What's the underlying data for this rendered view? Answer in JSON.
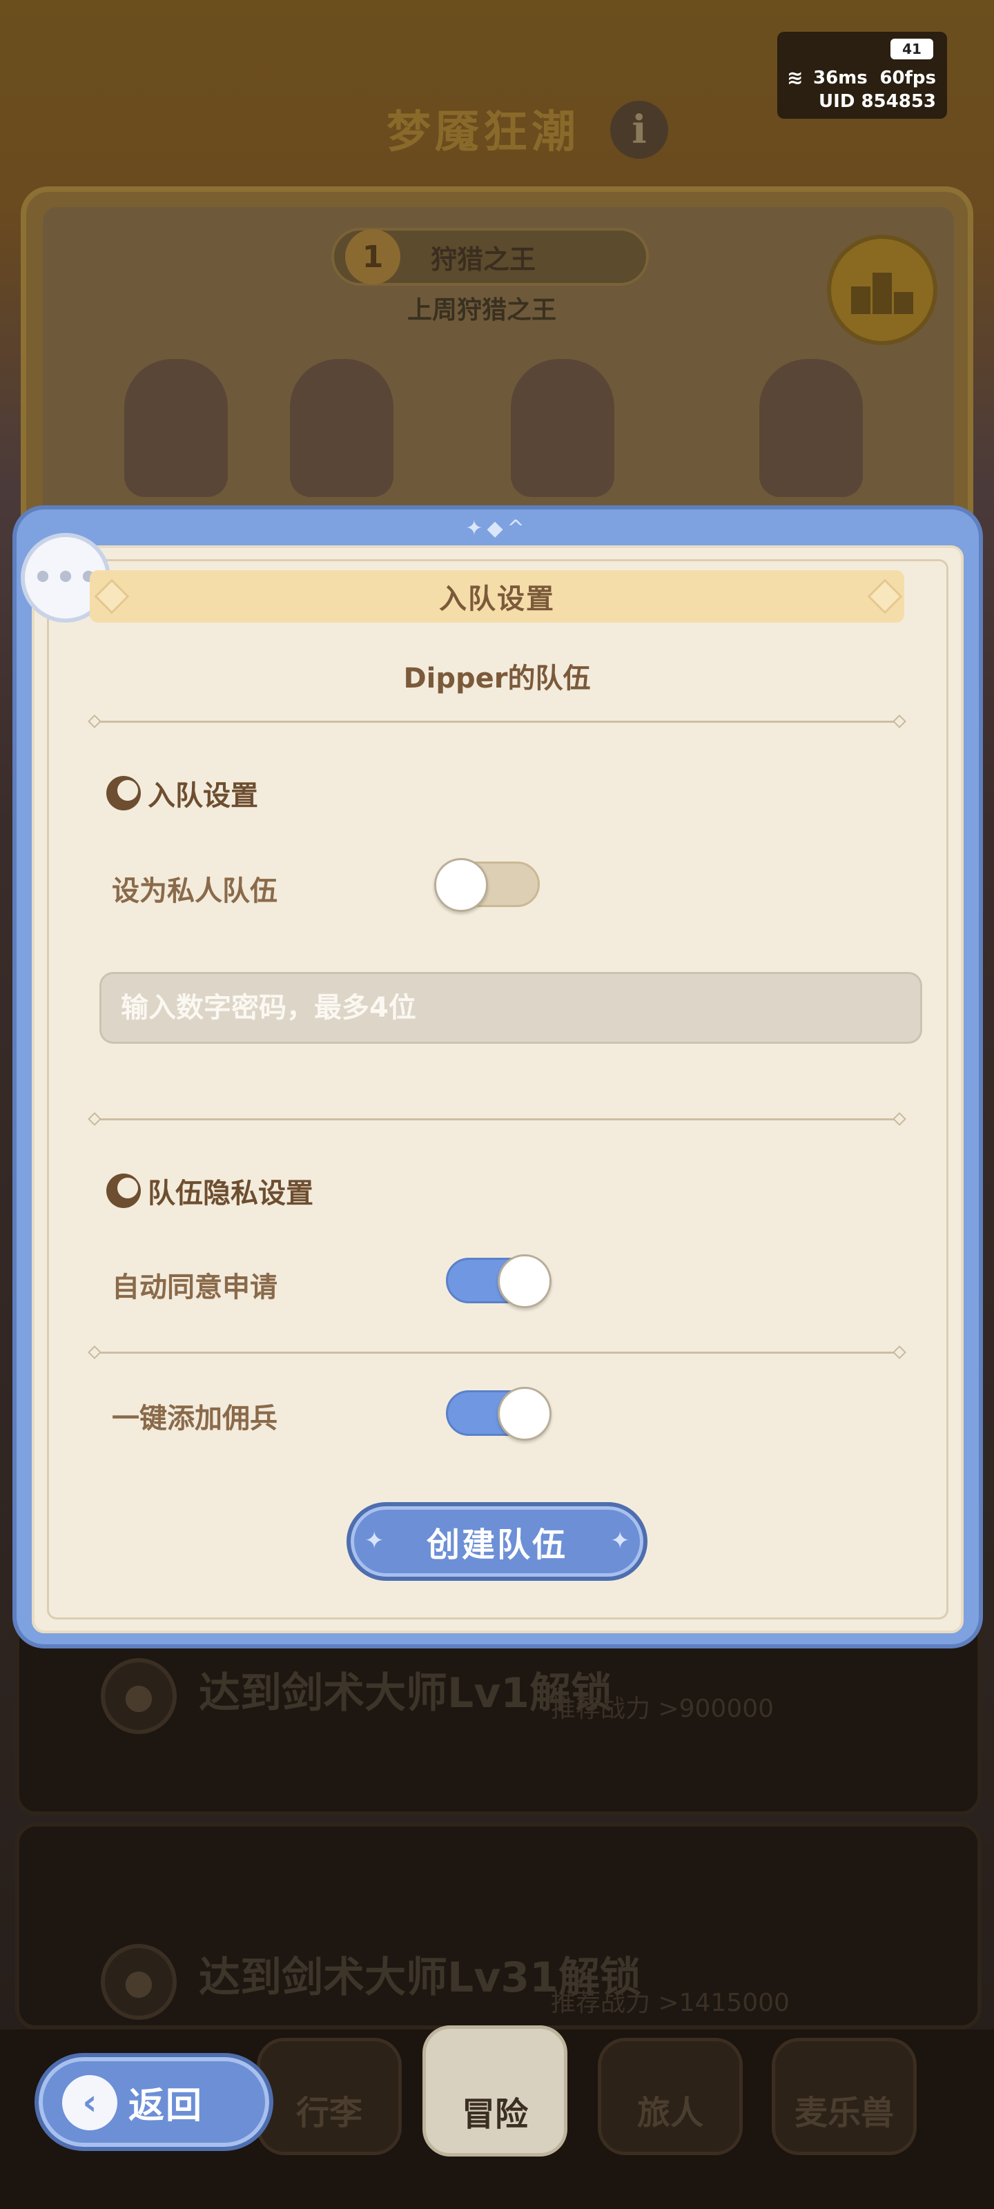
{
  "hud": {
    "battery": "41",
    "ping": "36ms",
    "fps": "60fps",
    "uid": "UID 854853"
  },
  "background": {
    "event_title": "梦魇狂潮",
    "info_icon": "i",
    "rank_number": "1",
    "rank_title": "狩猎之王",
    "rank_subtitle": "上周狩猎之王",
    "podium_icon": "podium-icon",
    "locked_rows": [
      {
        "text": "达到剑术大师Lv1解锁",
        "power": "推荐战力 >900000"
      },
      {
        "text": "达到剑术大师Lv31解锁",
        "power": "推荐战力 >1415000"
      }
    ]
  },
  "dialog": {
    "header": "入队设置",
    "team_name": "Dipper的队伍",
    "join_section": {
      "title": "入队设置",
      "private_label": "设为私人队伍",
      "private_on": false,
      "password_placeholder": "输入数字密码，最多4位",
      "password_value": ""
    },
    "privacy_section": {
      "title": "队伍隐私设置",
      "auto_accept_label": "自动同意申请",
      "auto_accept_on": true,
      "add_mercenary_label": "一键添加佣兵",
      "add_mercenary_on": true
    },
    "create_button": "创建队伍"
  },
  "back_button": "返回",
  "bottom_nav": {
    "tabs": [
      {
        "label": "行李",
        "active": false
      },
      {
        "label": "冒险",
        "active": true
      },
      {
        "label": "旅人",
        "active": false
      },
      {
        "label": "麦乐兽",
        "active": false
      }
    ]
  },
  "colors": {
    "dialog_frame": "#7ea1e0",
    "panel_bg": "#f3ecdd",
    "toggle_on": "#6f97e2",
    "text_brown": "#7b5a3a"
  }
}
